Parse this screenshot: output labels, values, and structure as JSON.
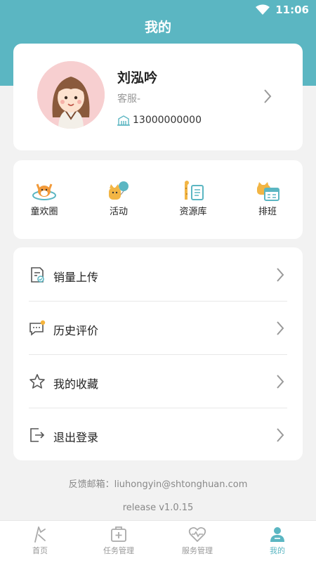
{
  "status_bar": {
    "time": "11:06"
  },
  "header": {
    "title": "我的"
  },
  "profile": {
    "name": "刘泓吟",
    "role": "客服-",
    "phone": "13000000000"
  },
  "quick_actions": [
    {
      "label": "童欢圈",
      "icon": "fox-circle-icon"
    },
    {
      "label": "活动",
      "icon": "cat-balloon-icon"
    },
    {
      "label": "资源库",
      "icon": "giraffe-book-icon"
    },
    {
      "label": "排班",
      "icon": "cat-calendar-icon"
    }
  ],
  "menu": [
    {
      "label": "销量上传",
      "icon": "upload-document-icon"
    },
    {
      "label": "历史评价",
      "icon": "comment-icon"
    },
    {
      "label": "我的收藏",
      "icon": "star-icon"
    },
    {
      "label": "退出登录",
      "icon": "logout-icon"
    }
  ],
  "footer": {
    "feedback": "反馈邮箱：liuhongyin@shtonghuan.com",
    "version": "release v1.0.15"
  },
  "tabbar": {
    "items": [
      {
        "label": "首页",
        "icon": "home-icon",
        "active": false
      },
      {
        "label": "任务管理",
        "icon": "task-icon",
        "active": false
      },
      {
        "label": "服务管理",
        "icon": "service-heart-icon",
        "active": false
      },
      {
        "label": "我的",
        "icon": "profile-icon",
        "active": true
      }
    ]
  },
  "colors": {
    "primary": "#5bb6c2",
    "background": "#f2f2f2",
    "notification_dot": "#f5b43c"
  }
}
